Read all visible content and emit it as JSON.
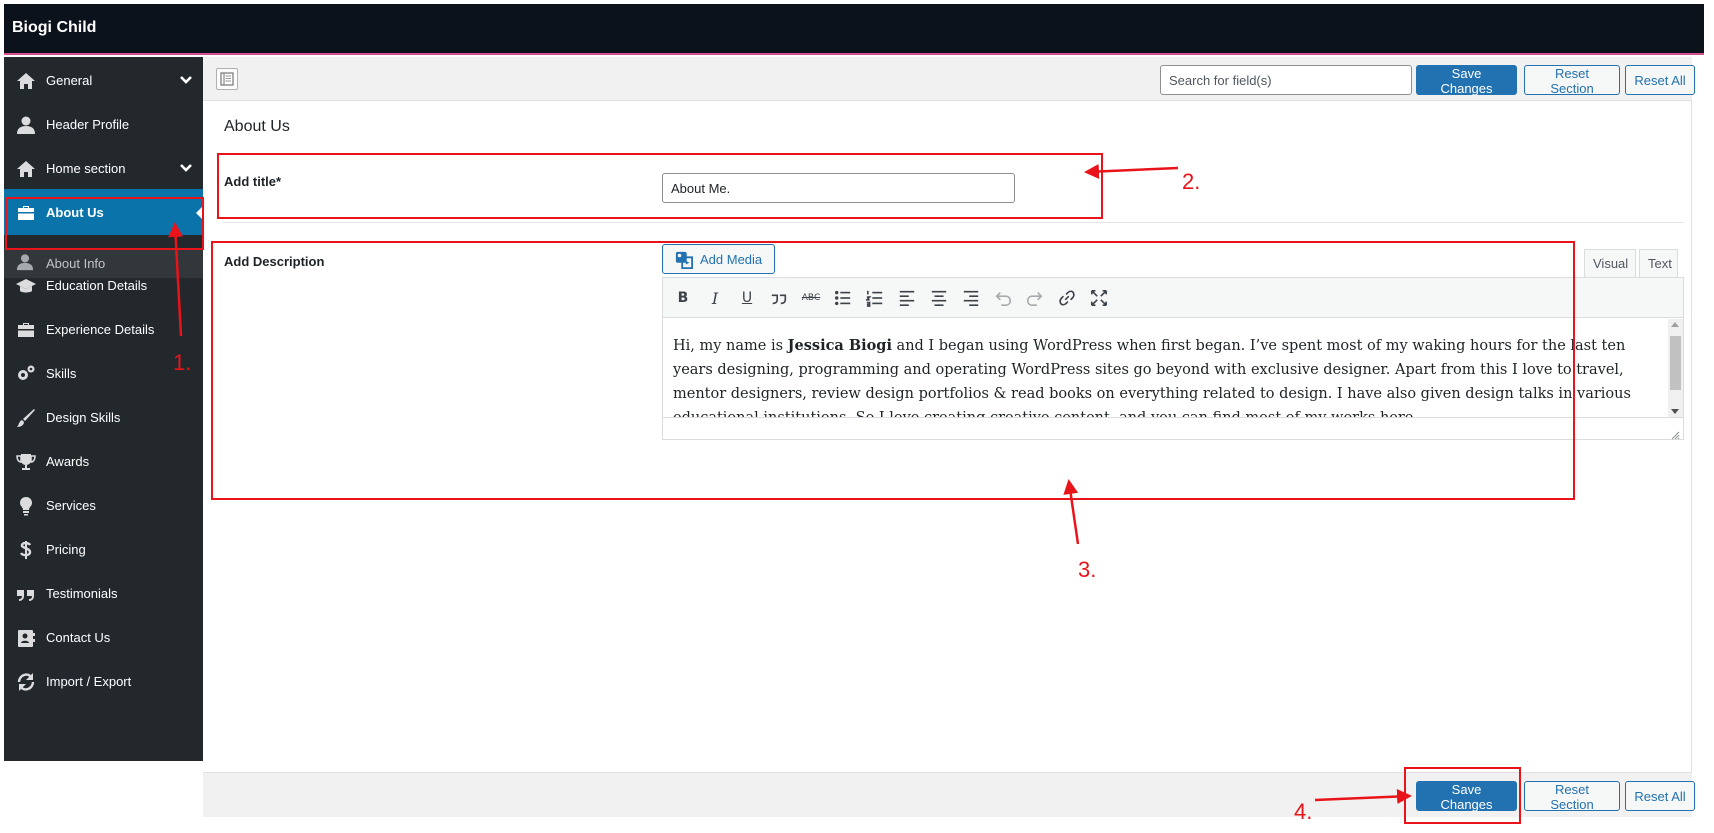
{
  "app": {
    "title": "Biogi Child"
  },
  "sidebar": {
    "items": [
      {
        "label": "General",
        "icon": "home-icon",
        "has_children": true
      },
      {
        "label": "Header Profile",
        "icon": "user-icon"
      },
      {
        "label": "Home section",
        "icon": "home-icon",
        "has_children": true
      },
      {
        "label": "About Us",
        "icon": "briefcase-icon",
        "active": true
      },
      {
        "label": "Education Details",
        "icon": "graduation-cap-icon"
      },
      {
        "label": "Experience Details",
        "icon": "briefcase-icon"
      },
      {
        "label": "Skills",
        "icon": "gears-icon"
      },
      {
        "label": "Design Skills",
        "icon": "brush-icon"
      },
      {
        "label": "Awards",
        "icon": "trophy-icon"
      },
      {
        "label": "Services",
        "icon": "lightbulb-icon"
      },
      {
        "label": "Pricing",
        "icon": "dollar-icon"
      },
      {
        "label": "Testimonials",
        "icon": "quote-icon"
      },
      {
        "label": "Contact Us",
        "icon": "address-card-icon"
      },
      {
        "label": "Import / Export",
        "icon": "refresh-icon"
      }
    ],
    "subitem": {
      "label": "About Info",
      "icon": "user-icon"
    }
  },
  "toolbar": {
    "search_placeholder": "Search for field(s)",
    "save_label": "Save Changes",
    "reset_section_label": "Reset Section",
    "reset_all_label": "Reset All"
  },
  "section": {
    "title": "About Us",
    "fields": {
      "title_label": "Add title*",
      "title_value": "About Me.",
      "description_label": "Add Description"
    }
  },
  "editor": {
    "add_media_label": "Add Media",
    "tabs": {
      "visual": "Visual",
      "text": "Text"
    },
    "content": {
      "before_bold": "Hi, my name is ",
      "bold": "Jessica Biogi",
      "after_bold": " and I began using WordPress when first began. I’ve spent most of my waking hours for the last ten years designing, programming and operating WordPress sites go beyond with exclusive designer. Apart from this I love to travel, mentor designers, review design portfolios & read books on everything related to design. I have also given design talks in various educational institutions. So I love creating creative content, and you can find most of my works here."
    },
    "toolbar_icons": [
      "bold-icon",
      "italic-icon",
      "underline-icon",
      "blockquote-icon",
      "strikethrough-icon",
      "bullet-list-icon",
      "numbered-list-icon",
      "align-left-icon",
      "align-center-icon",
      "align-right-icon",
      "undo-icon",
      "redo-icon",
      "link-icon",
      "fullscreen-icon"
    ]
  },
  "annotations": {
    "step1": "1.",
    "step2": "2.",
    "step3": "3.",
    "step4": "4."
  },
  "colors": {
    "accent": "#2271b1",
    "sidebar": "#23282d",
    "active": "#0a73aa",
    "annotation": "#e8141a",
    "topbar": "#0c121b"
  }
}
